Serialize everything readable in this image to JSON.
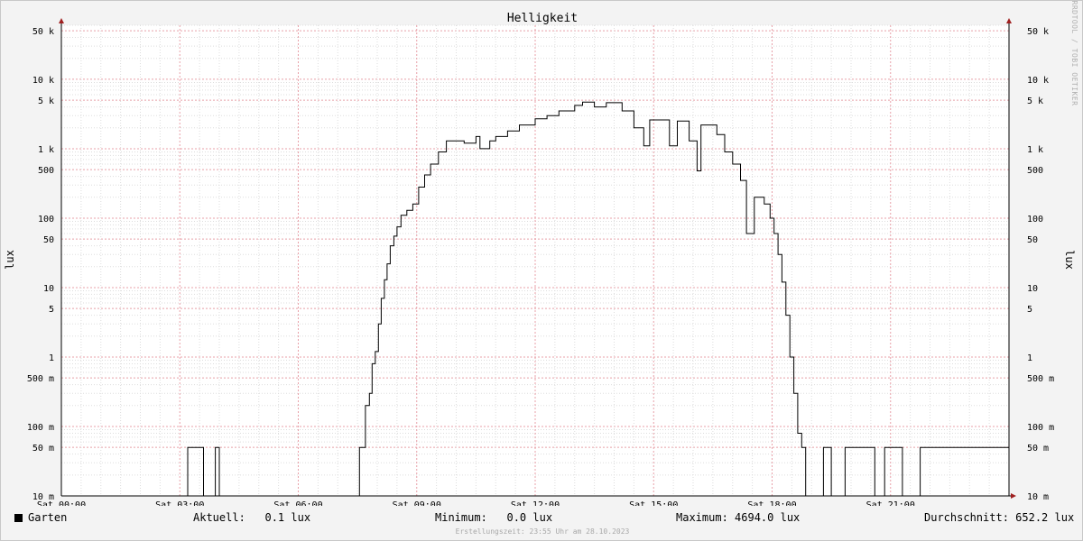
{
  "chart_data": {
    "type": "line",
    "title": "Helligkeit",
    "ylabel": "lux",
    "ylabel_right": "lux",
    "watermark": "RRDTOOL / TOBI OETIKER",
    "scale": "log",
    "xlim": [
      0,
      24
    ],
    "ylim": [
      0.01,
      60000
    ],
    "grid": true,
    "x_ticks": [
      {
        "value": 0,
        "label": "Sat 00:00"
      },
      {
        "value": 3,
        "label": "Sat 03:00"
      },
      {
        "value": 6,
        "label": "Sat 06:00"
      },
      {
        "value": 9,
        "label": "Sat 09:00"
      },
      {
        "value": 12,
        "label": "Sat 12:00"
      },
      {
        "value": 15,
        "label": "Sat 15:00"
      },
      {
        "value": 18,
        "label": "Sat 18:00"
      },
      {
        "value": 21,
        "label": "Sat 21:00"
      }
    ],
    "y_ticks": [
      {
        "value": 0.01,
        "label": "10 m"
      },
      {
        "value": 0.05,
        "label": "50 m"
      },
      {
        "value": 0.1,
        "label": "100 m"
      },
      {
        "value": 0.5,
        "label": "500 m"
      },
      {
        "value": 1,
        "label": "1"
      },
      {
        "value": 5,
        "label": "5"
      },
      {
        "value": 10,
        "label": "10"
      },
      {
        "value": 50,
        "label": "50"
      },
      {
        "value": 100,
        "label": "100"
      },
      {
        "value": 500,
        "label": "500"
      },
      {
        "value": 1000,
        "label": "1 k"
      },
      {
        "value": 5000,
        "label": "5 k"
      },
      {
        "value": 10000,
        "label": "10 k"
      },
      {
        "value": 50000,
        "label": "50 k"
      }
    ],
    "colors": {
      "background": "#ffffff",
      "canvas_frame": "#f3f3f3",
      "minor_grid": "#dddddd",
      "major_grid": "#e8a0a8",
      "series": "#000000",
      "arrow": "#a02020"
    },
    "series": [
      {
        "name": "Garten",
        "color": "#000000",
        "points": [
          [
            0.0,
            0.01
          ],
          [
            3.2,
            0.01
          ],
          [
            3.2,
            0.05
          ],
          [
            3.6,
            0.05
          ],
          [
            3.6,
            0.01
          ],
          [
            3.9,
            0.01
          ],
          [
            3.9,
            0.05
          ],
          [
            4.0,
            0.05
          ],
          [
            4.0,
            0.01
          ],
          [
            7.55,
            0.01
          ],
          [
            7.55,
            0.05
          ],
          [
            7.7,
            0.05
          ],
          [
            7.7,
            0.2
          ],
          [
            7.8,
            0.2
          ],
          [
            7.8,
            0.3
          ],
          [
            7.87,
            0.3
          ],
          [
            7.87,
            0.8
          ],
          [
            7.95,
            0.8
          ],
          [
            7.95,
            1.2
          ],
          [
            8.03,
            1.2
          ],
          [
            8.03,
            3
          ],
          [
            8.1,
            3
          ],
          [
            8.1,
            7
          ],
          [
            8.18,
            7
          ],
          [
            8.18,
            13
          ],
          [
            8.25,
            13
          ],
          [
            8.25,
            22
          ],
          [
            8.33,
            22
          ],
          [
            8.33,
            40
          ],
          [
            8.42,
            40
          ],
          [
            8.42,
            55
          ],
          [
            8.5,
            55
          ],
          [
            8.5,
            75
          ],
          [
            8.6,
            75
          ],
          [
            8.6,
            110
          ],
          [
            8.75,
            110
          ],
          [
            8.75,
            130
          ],
          [
            8.9,
            130
          ],
          [
            8.9,
            160
          ],
          [
            9.05,
            160
          ],
          [
            9.05,
            280
          ],
          [
            9.2,
            280
          ],
          [
            9.2,
            420
          ],
          [
            9.35,
            420
          ],
          [
            9.35,
            600
          ],
          [
            9.55,
            600
          ],
          [
            9.55,
            900
          ],
          [
            9.75,
            900
          ],
          [
            9.75,
            1300
          ],
          [
            10.2,
            1300
          ],
          [
            10.2,
            1200
          ],
          [
            10.5,
            1200
          ],
          [
            10.5,
            1500
          ],
          [
            10.6,
            1500
          ],
          [
            10.6,
            1000
          ],
          [
            10.85,
            1000
          ],
          [
            10.85,
            1300
          ],
          [
            11.0,
            1300
          ],
          [
            11.0,
            1500
          ],
          [
            11.3,
            1500
          ],
          [
            11.3,
            1800
          ],
          [
            11.6,
            1800
          ],
          [
            11.6,
            2200
          ],
          [
            12.0,
            2200
          ],
          [
            12.0,
            2700
          ],
          [
            12.3,
            2700
          ],
          [
            12.3,
            3000
          ],
          [
            12.6,
            3000
          ],
          [
            12.6,
            3500
          ],
          [
            13.0,
            3500
          ],
          [
            13.0,
            4200
          ],
          [
            13.2,
            4200
          ],
          [
            13.2,
            4694
          ],
          [
            13.5,
            4694
          ],
          [
            13.5,
            4000
          ],
          [
            13.8,
            4000
          ],
          [
            13.8,
            4600
          ],
          [
            14.2,
            4600
          ],
          [
            14.2,
            3500
          ],
          [
            14.5,
            3500
          ],
          [
            14.5,
            2000
          ],
          [
            14.75,
            2000
          ],
          [
            14.75,
            1100
          ],
          [
            14.9,
            1100
          ],
          [
            14.9,
            2600
          ],
          [
            15.4,
            2600
          ],
          [
            15.4,
            1100
          ],
          [
            15.6,
            1100
          ],
          [
            15.6,
            2500
          ],
          [
            15.9,
            2500
          ],
          [
            15.9,
            1300
          ],
          [
            16.1,
            1300
          ],
          [
            16.1,
            480
          ],
          [
            16.2,
            480
          ],
          [
            16.2,
            2200
          ],
          [
            16.6,
            2200
          ],
          [
            16.6,
            1600
          ],
          [
            16.8,
            1600
          ],
          [
            16.8,
            900
          ],
          [
            17.0,
            900
          ],
          [
            17.0,
            600
          ],
          [
            17.2,
            600
          ],
          [
            17.2,
            350
          ],
          [
            17.35,
            350
          ],
          [
            17.35,
            60
          ],
          [
            17.55,
            60
          ],
          [
            17.55,
            200
          ],
          [
            17.8,
            200
          ],
          [
            17.8,
            160
          ],
          [
            17.95,
            160
          ],
          [
            17.95,
            100
          ],
          [
            18.05,
            100
          ],
          [
            18.05,
            60
          ],
          [
            18.15,
            60
          ],
          [
            18.15,
            30
          ],
          [
            18.25,
            30
          ],
          [
            18.25,
            12
          ],
          [
            18.35,
            12
          ],
          [
            18.35,
            4
          ],
          [
            18.45,
            4
          ],
          [
            18.45,
            1
          ],
          [
            18.55,
            1
          ],
          [
            18.55,
            0.3
          ],
          [
            18.65,
            0.3
          ],
          [
            18.65,
            0.08
          ],
          [
            18.75,
            0.08
          ],
          [
            18.75,
            0.05
          ],
          [
            18.85,
            0.05
          ],
          [
            18.85,
            0.01
          ],
          [
            19.3,
            0.01
          ],
          [
            19.3,
            0.05
          ],
          [
            19.5,
            0.05
          ],
          [
            19.5,
            0.01
          ],
          [
            19.85,
            0.01
          ],
          [
            19.85,
            0.05
          ],
          [
            20.6,
            0.05
          ],
          [
            20.6,
            0.01
          ],
          [
            20.85,
            0.01
          ],
          [
            20.85,
            0.05
          ],
          [
            21.3,
            0.05
          ],
          [
            21.3,
            0.01
          ],
          [
            21.75,
            0.01
          ],
          [
            21.75,
            0.05
          ],
          [
            24.0,
            0.05
          ]
        ]
      }
    ]
  },
  "legend": {
    "series_name": "Garten",
    "current": "Aktuell:   0.1 lux",
    "minimum": "Minimum:   0.0 lux",
    "maximum": "Maximum: 4694.0 lux",
    "average": "Durchschnitt: 652.2 lux"
  },
  "footer": "Erstellungszeit: 23:55 Uhr am 28.10.2023"
}
